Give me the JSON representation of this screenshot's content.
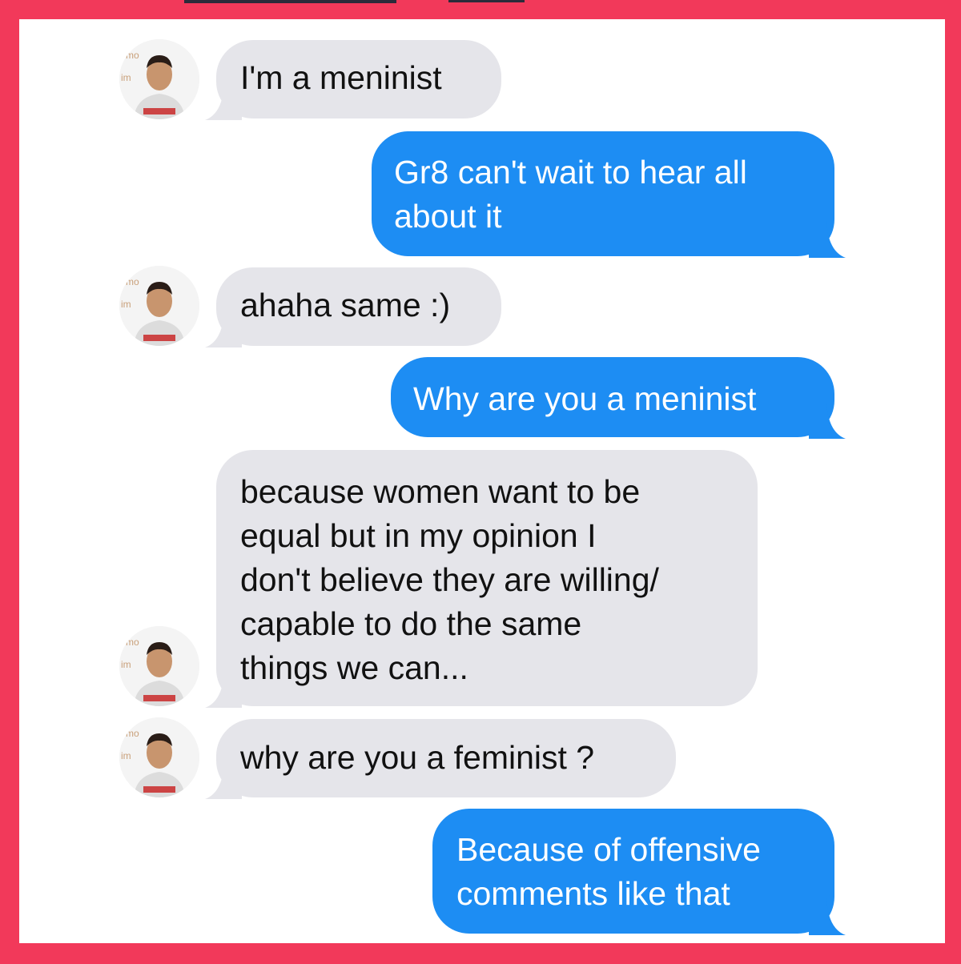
{
  "colors": {
    "frame": "#f2395a",
    "incoming_bubble": "#e5e5ea",
    "outgoing_bubble": "#1d8df3",
    "incoming_text": "#111111",
    "outgoing_text": "#ffffff"
  },
  "messages": [
    {
      "direction": "incoming",
      "text": "I'm a meninist",
      "avatar": "contact-photo"
    },
    {
      "direction": "outgoing",
      "text": "Gr8 can't wait to hear all\nabout it"
    },
    {
      "direction": "incoming",
      "text": "ahaha same :)",
      "avatar": "contact-photo"
    },
    {
      "direction": "outgoing",
      "text": "Why are you a meninist"
    },
    {
      "direction": "incoming",
      "text": "because women want to be\nequal but in my opinion I\ndon't believe they are willing/\ncapable to do the same\nthings we can...",
      "avatar": "contact-photo"
    },
    {
      "direction": "incoming",
      "text": "why are you a feminist ?",
      "avatar": "contact-photo"
    },
    {
      "direction": "outgoing",
      "text": "Because of offensive\ncomments like that"
    }
  ]
}
